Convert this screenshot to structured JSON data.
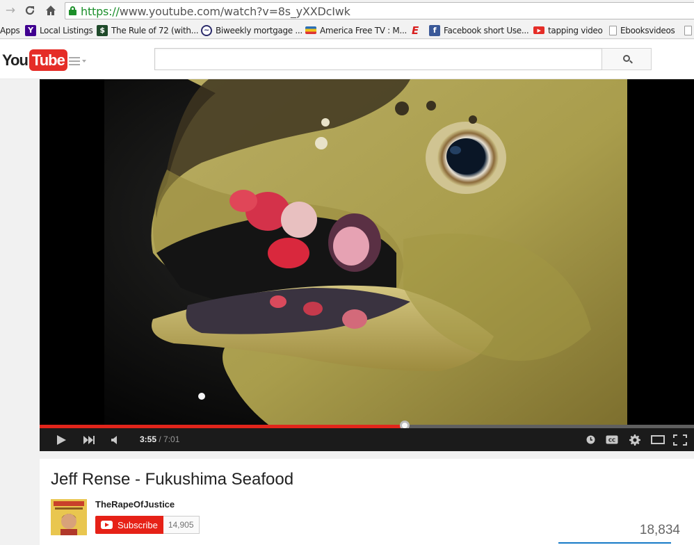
{
  "browser": {
    "url_scheme": "https://",
    "url_rest": "www.youtube.com/watch?v=8s_yXXDcIwk",
    "bookmarks": [
      {
        "label": "Apps",
        "icon": "apps-icon"
      },
      {
        "label": "Local Listings",
        "icon": "yahoo-icon",
        "color": "#400090",
        "glyph": "Y"
      },
      {
        "label": "The Rule of 72 (with...",
        "icon": "dollar-icon",
        "color": "#1f4a2a",
        "glyph": "$"
      },
      {
        "label": "Biweekly mortgage ...",
        "icon": "chart-circle-icon",
        "color": "#2b2b6b",
        "glyph": "~"
      },
      {
        "label": "America Free TV : M...",
        "icon": "flag-icon",
        "color": "#2b6fb5",
        "glyph": ""
      },
      {
        "label": "",
        "icon": "e-logo-icon",
        "color": "#d81e1e",
        "glyph": "E"
      },
      {
        "label": "Facebook short Use...",
        "icon": "facebook-icon",
        "color": "#3b5998",
        "glyph": "f"
      },
      {
        "label": "tapping video",
        "icon": "youtube-icon",
        "color": "#e52d27",
        "glyph": "▶"
      },
      {
        "label": "Ebooksvideos",
        "icon": "page-icon",
        "color": "#ffffff",
        "glyph": ""
      }
    ]
  },
  "header": {
    "logo_you": "You",
    "logo_tube": "Tube",
    "search_placeholder": ""
  },
  "player": {
    "current_time": "3:55",
    "duration": " / 7:01",
    "progress_fraction": 0.558
  },
  "video": {
    "title": "Jeff Rense - Fukushima Seafood",
    "channel": "TheRapeOfJustice",
    "subscribe_label": "Subscribe",
    "subscriber_count": "14,905",
    "views": "18,834"
  },
  "colors": {
    "accent": "#e52d27",
    "url_green": "#1c8f2c"
  }
}
